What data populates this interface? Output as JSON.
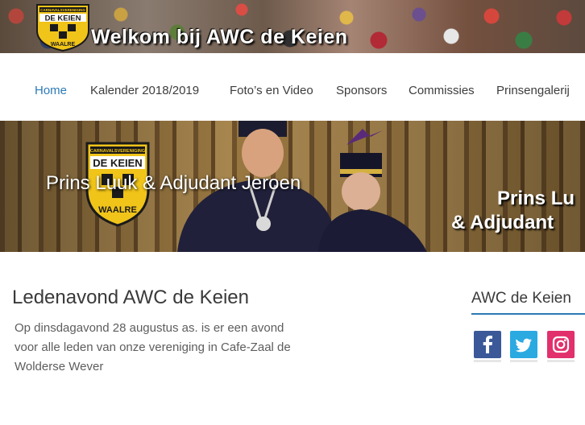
{
  "header": {
    "title": "Welkom bij AWC de Keien",
    "logo_top_text": "CARNAVALSVERENIGING",
    "logo_main_text": "DE KEIEN",
    "logo_bottom_text": "WAALRE"
  },
  "nav": {
    "items": [
      {
        "label": "Home",
        "active": true
      },
      {
        "label": "Kalender 2018/2019",
        "active": false
      },
      {
        "label": "Foto’s en Video",
        "active": false
      },
      {
        "label": "Sponsors",
        "active": false
      },
      {
        "label": "Commissies",
        "active": false
      },
      {
        "label": "Prinsengalerij",
        "active": false
      }
    ],
    "active_color": "#2c7ab5"
  },
  "slider": {
    "caption": "Prins Luuk & Adjudant Jeroen",
    "caption_right_line1": "Prins Lu",
    "caption_right_line2": "& Adjudant",
    "logo_top_text": "CARNAVALSVERENIGING",
    "logo_main_text": "DE KEIEN",
    "logo_bottom_text": "WAALRE"
  },
  "post": {
    "title": "Ledenavond AWC de Keien",
    "body": "Op dinsdagavond 28 augustus as. is er een avond voor alle leden van onze vereniging in Cafe-Zaal de Wolderse Wever"
  },
  "sidebar": {
    "widget_title": "AWC de Keien",
    "social": [
      {
        "name": "facebook",
        "icon": "facebook-icon",
        "color": "#3b5998"
      },
      {
        "name": "twitter",
        "icon": "twitter-icon",
        "color": "#2ba9e1"
      },
      {
        "name": "instagram",
        "icon": "instagram-icon",
        "color": "#e1306c"
      }
    ]
  }
}
